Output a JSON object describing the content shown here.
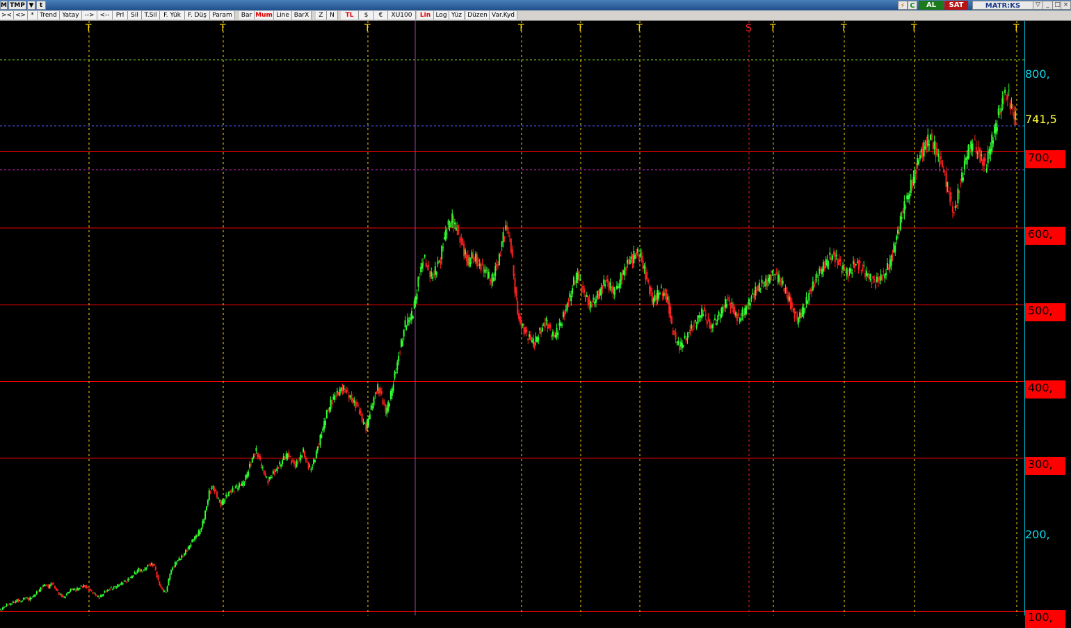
{
  "titlebar": {
    "m_label": "M",
    "symbol": "TMP",
    "al_label": "AL",
    "sat_label": "SAT",
    "brand": "MATR:KS",
    "c_label": "C",
    "lightning": "⚡"
  },
  "toolbar": {
    "buttons": [
      ">< ",
      "<>",
      "*",
      "Trend",
      "Yatay",
      "-->",
      "<--",
      "Prl",
      "Sil",
      "T.Sil",
      "F. Yük",
      "F. Düş",
      "Param",
      "Bar",
      "Mum",
      "Line",
      "BarX",
      "Z",
      "N",
      "TL",
      "$",
      "€",
      "XU100",
      "Lin",
      "Log",
      "Yüz",
      "Düzen",
      "Var.Kyd"
    ],
    "active": [
      "Mum",
      "TL",
      "Lin"
    ]
  },
  "price_axis": {
    "labels": [
      "800,",
      "700,",
      "600,",
      "500,",
      "400,",
      "300,",
      "200,",
      "100,"
    ],
    "last_price": "741,5"
  },
  "signals": [
    "T",
    "T",
    "T",
    "T",
    "T",
    "T",
    "S",
    "T",
    "T",
    "T",
    "T"
  ],
  "colors": {
    "up_candle": "#30ff30",
    "down_candle": "#ff2020",
    "grid_red": "#ff0000",
    "axis": "#10d8e8",
    "signal_T": "#ffd800",
    "signal_S": "#ff2020"
  },
  "chart_data": {
    "type": "candlestick",
    "ylim": [
      95,
      870
    ],
    "levels": [
      100,
      300,
      400,
      500,
      600,
      700
    ],
    "last": 741.5,
    "series": [
      {
        "values": [
          102,
          108,
          110,
          112,
          115,
          113,
          118,
          116,
          120,
          125,
          130,
          135,
          132,
          138,
          128,
          122,
          118,
          125,
          130,
          128,
          132,
          134,
          130,
          126,
          122,
          118,
          124,
          128,
          130,
          132,
          135,
          138,
          140,
          145,
          150,
          155,
          152,
          158,
          162,
          160,
          140,
          128,
          125,
          150,
          160,
          168,
          172,
          178,
          185,
          195,
          200,
          210,
          230,
          255,
          262,
          250,
          240,
          248,
          255,
          258,
          262,
          265,
          270,
          285,
          300,
          310,
          295,
          280,
          270,
          278,
          285,
          292,
          300,
          305,
          296,
          290,
          300,
          310,
          292,
          285,
          300,
          320,
          340,
          360,
          372,
          380,
          385,
          392,
          388,
          380,
          372,
          365,
          350,
          340,
          360,
          378,
          392,
          380,
          360,
          375,
          400,
          425,
          450,
          475,
          480,
          490,
          520,
          550,
          560,
          545,
          535,
          548,
          560,
          590,
          605,
          612,
          598,
          585,
          570,
          555,
          565,
          560,
          550,
          545,
          540,
          530,
          548,
          560,
          590,
          600,
          575,
          520,
          480,
          470,
          460,
          455,
          450,
          462,
          470,
          478,
          465,
          458,
          468,
          480,
          495,
          510,
          530,
          540,
          520,
          510,
          500,
          505,
          512,
          520,
          530,
          525,
          518,
          522,
          535,
          545,
          555,
          560,
          570,
          565,
          545,
          525,
          505,
          510,
          520,
          515,
          505,
          470,
          455,
          445,
          452,
          460,
          470,
          475,
          485,
          492,
          480,
          470,
          478,
          485,
          495,
          505,
          500,
          490,
          482,
          488,
          495,
          505,
          515,
          522,
          530,
          528,
          535,
          540,
          535,
          530,
          520,
          505,
          490,
          480,
          488,
          500,
          515,
          525,
          535,
          545,
          552,
          560,
          565,
          560,
          550,
          545,
          540,
          548,
          555,
          550,
          545,
          538,
          532,
          528,
          535,
          540,
          548,
          560,
          580,
          600,
          625,
          640,
          655,
          670,
          690,
          700,
          712,
          720,
          705,
          690,
          680,
          660,
          640,
          620,
          645,
          665,
          690,
          705,
          710,
          700,
          690,
          680,
          700,
          720,
          740,
          760,
          775,
          770,
          750,
          740
        ]
      }
    ]
  }
}
